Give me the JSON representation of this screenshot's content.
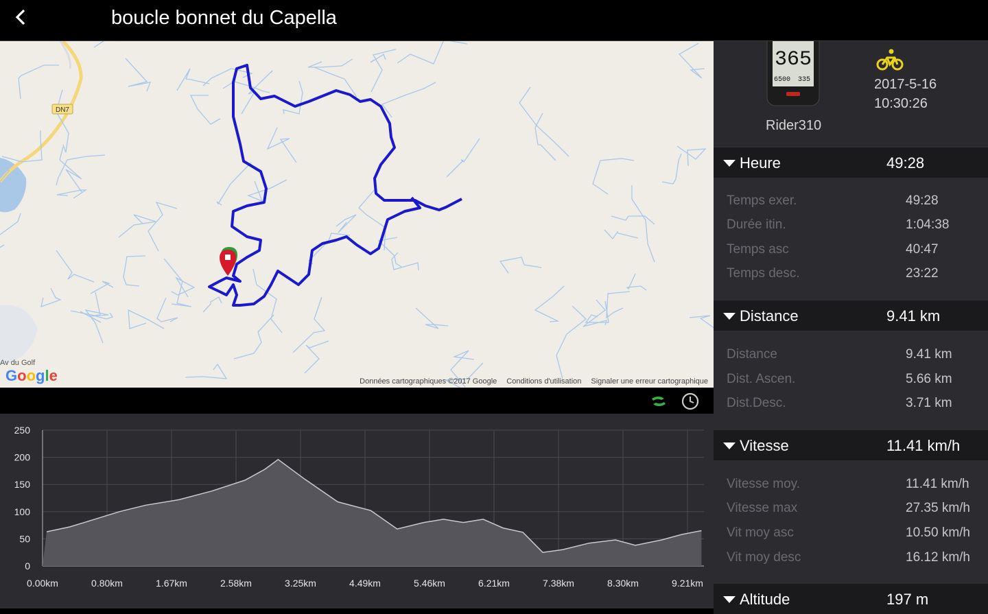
{
  "header": {
    "title": "boucle bonnet du Capella"
  },
  "map": {
    "road_label": "DN7",
    "place_label": "Av du Golf",
    "logo": "Google",
    "credits": [
      "Données cartographiques ©2017 Google",
      "Conditions d'utilisation",
      "Signaler une erreur cartographique"
    ]
  },
  "device": {
    "screen_big": "365",
    "screen_small_1": "6500",
    "screen_small_2": "335",
    "name": "Rider310",
    "activity_icon": "bicycle-icon",
    "date": "2017-5-16",
    "time": "10:30:26"
  },
  "sections": {
    "heure": {
      "label": "Heure",
      "value": "49:28",
      "rows": [
        {
          "k": "Temps exer.",
          "v": "49:28"
        },
        {
          "k": "Durée itin.",
          "v": "1:04:38"
        },
        {
          "k": "Temps asc",
          "v": "40:47"
        },
        {
          "k": "Temps desc.",
          "v": "23:22"
        }
      ]
    },
    "distance": {
      "label": "Distance",
      "value": "9.41 km",
      "rows": [
        {
          "k": "Distance",
          "v": "9.41 km"
        },
        {
          "k": "Dist. Ascen.",
          "v": "5.66 km"
        },
        {
          "k": "Dist.Desc.",
          "v": "3.71 km"
        }
      ]
    },
    "vitesse": {
      "label": "Vitesse",
      "value": "11.41 km/h",
      "rows": [
        {
          "k": "Vitesse moy.",
          "v": "11.41 km/h"
        },
        {
          "k": "Vitesse max",
          "v": "27.35 km/h"
        },
        {
          "k": "Vit moy asc",
          "v": "10.50 km/h"
        },
        {
          "k": "Vit moy desc",
          "v": "16.12 km/h"
        }
      ]
    },
    "altitude": {
      "label": "Altitude",
      "value": "197 m"
    }
  },
  "colors": {
    "route": "#1a1acc",
    "accent": "#e8d21a",
    "panel": "#2c2c30"
  },
  "chart_data": {
    "type": "area",
    "x_ticks": [
      "0.00km",
      "0.80km",
      "1.67km",
      "2.58km",
      "3.25km",
      "4.49km",
      "5.46km",
      "6.21km",
      "7.38km",
      "8.30km",
      "9.21km"
    ],
    "y_ticks": [
      "0",
      "50",
      "100",
      "150",
      "200",
      "250"
    ],
    "ylim": [
      0,
      250
    ],
    "xlim": [
      0,
      10
    ],
    "grid": true,
    "x": [
      0,
      0.35,
      0.7,
      1.1,
      1.5,
      2.0,
      2.5,
      3.0,
      3.3,
      3.5,
      3.9,
      4.4,
      4.9,
      5.3,
      5.7,
      6.0,
      6.3,
      6.6,
      6.9,
      7.2,
      7.5,
      7.8,
      8.2,
      8.6,
      8.9,
      9.3,
      9.6,
      9.9
    ],
    "y": [
      63,
      72,
      85,
      100,
      112,
      122,
      138,
      158,
      178,
      196,
      160,
      118,
      102,
      68,
      80,
      86,
      80,
      86,
      70,
      62,
      25,
      30,
      42,
      48,
      38,
      48,
      58,
      65
    ],
    "series": [
      {
        "values": []
      }
    ]
  }
}
